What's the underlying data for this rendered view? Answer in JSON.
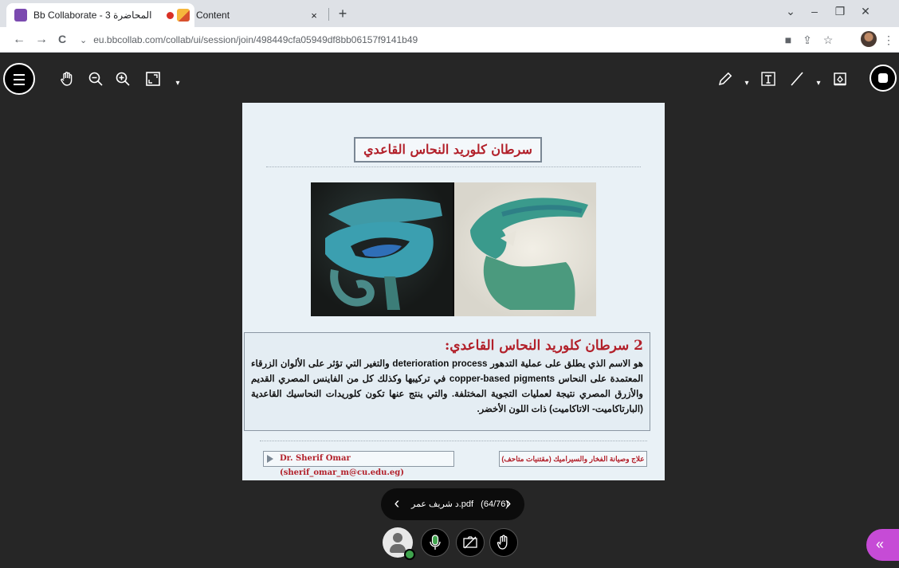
{
  "browser": {
    "tabs": [
      {
        "title": "Bb Collaborate - المحاضرة 3",
        "recording": true,
        "close": "×"
      },
      {
        "title": "Content",
        "close": "×"
      }
    ],
    "new_tab": "+",
    "window_controls": {
      "dropdown": "⌄",
      "minimize": "–",
      "restore": "❐",
      "close": "✕"
    },
    "nav": {
      "back": "←",
      "forward": "→",
      "reload": "C"
    },
    "url": "eu.bbcollab.com/collab/ui/session/join/498449cfa05949df8bb06157f9141b49"
  },
  "collaborate": {
    "toolbar_icons": [
      "menu-icon",
      "pan-hand-icon",
      "zoom-out-icon",
      "zoom-in-icon",
      "fit-page-icon",
      "pencil-icon",
      "text-tool-icon",
      "line-tool-icon",
      "eraser-icon",
      "stop-recording-icon"
    ],
    "slide": {
      "title": "سرطان كلوريد النحاس القاعدي",
      "section_heading": "2 سرطان كلوريد النحاس القاعدي:",
      "body": "هو الاسم الذي يطلق على عملية التدهور deterioration process والتغير التي تؤثر على الألوان الزرقاء المعتمدة على النحاس copper-based pigments في تركيبها وكذلك كل من الفاينس المصري القديم والأزرق المصري نتيجة لعمليات التجوية المختلفة. والتي ينتج عنها تكون كلوريدات النحاسيك القاعدية (البارتاكاميت- الاتاكاميت) ذات اللون الأخضر.",
      "footer_left": "Dr. Sherif Omar (sherif_omar_m@cu.edu.eg)",
      "footer_right": "علاج وصيانة الفخار والسيراميك (مقتنيات متاحف)"
    },
    "pager": {
      "file_name": "د شريف عمر.pdf",
      "page_indicator": "(64/76)",
      "prev": "‹",
      "next": "›"
    },
    "colors": {
      "accent": "#b2202a",
      "collab_panel": "#c64bd6",
      "status_ok": "#3fa34d"
    }
  }
}
